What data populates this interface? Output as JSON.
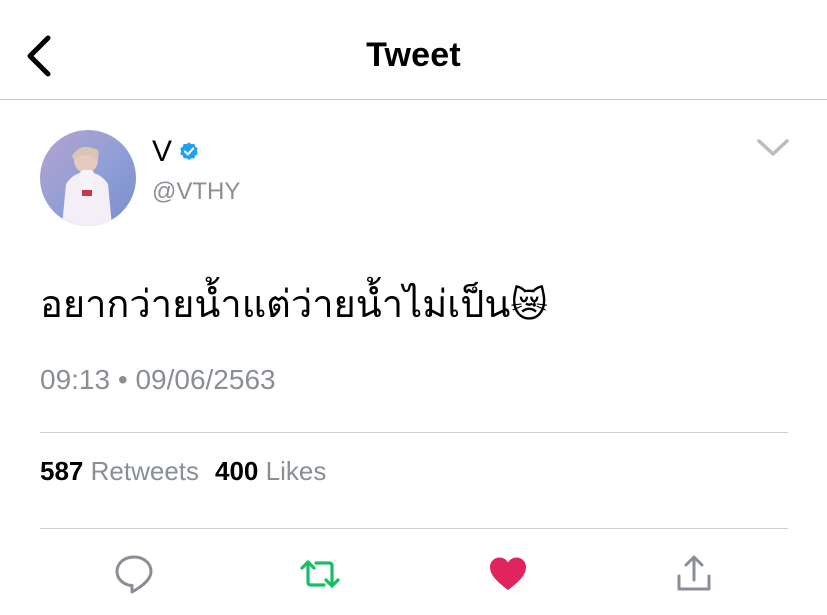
{
  "header": {
    "back_icon": "chevron-left-icon",
    "title": "Tweet"
  },
  "tweet": {
    "author": {
      "display_name": "V",
      "handle": "@VTHY",
      "verified": true,
      "verified_icon": "verified-badge-icon"
    },
    "menu_icon": "chevron-down-icon",
    "text": "อยากว่ายน้ำแต่ว่ายน้ำไม่เป็น",
    "emoji": "😿",
    "time": "09:13",
    "separator": "•",
    "date": "09/06/2563",
    "stats": {
      "retweets_count": "587",
      "retweets_label": "Retweets",
      "likes_count": "400",
      "likes_label": "Likes"
    }
  },
  "actions": [
    {
      "name": "reply",
      "icon": "reply-bubble-icon"
    },
    {
      "name": "retweet",
      "icon": "retweet-icon"
    },
    {
      "name": "like",
      "icon": "heart-icon"
    },
    {
      "name": "share",
      "icon": "share-upload-icon"
    }
  ],
  "colors": {
    "secondary_text": "#8a8f95",
    "verified_blue": "#1da1f2",
    "retweet_green": "#17bf63",
    "like_red": "#e0245e",
    "reply_gray": "#8a8f95",
    "divider": "#d0d0d4"
  }
}
